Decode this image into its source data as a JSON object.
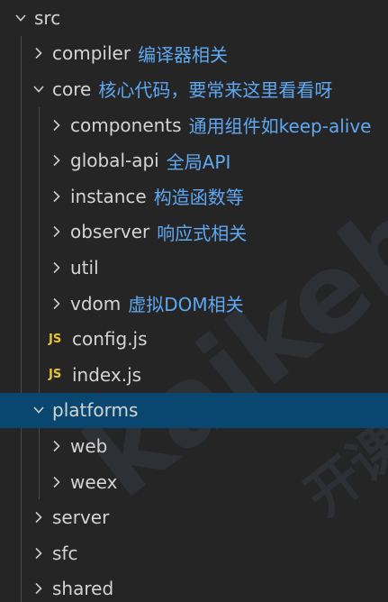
{
  "explorer": {
    "items": [
      {
        "label": "src",
        "note": "",
        "depth": 0,
        "icon": "chevron-down-icon",
        "expanded": true
      },
      {
        "label": "compiler",
        "note": "编译器相关",
        "depth": 1,
        "icon": "chevron-right-icon",
        "expanded": false
      },
      {
        "label": "core",
        "note": "核心代码，要常来这里看看呀",
        "depth": 1,
        "icon": "chevron-down-icon",
        "expanded": true
      },
      {
        "label": "components",
        "note": "通用组件如keep-alive",
        "depth": 2,
        "icon": "chevron-right-icon",
        "expanded": false
      },
      {
        "label": "global-api",
        "note": "全局API",
        "depth": 2,
        "icon": "chevron-right-icon",
        "expanded": false
      },
      {
        "label": "instance",
        "note": "构造函数等",
        "depth": 2,
        "icon": "chevron-right-icon",
        "expanded": false
      },
      {
        "label": "observer",
        "note": "响应式相关",
        "depth": 2,
        "icon": "chevron-right-icon",
        "expanded": false
      },
      {
        "label": "util",
        "note": "",
        "depth": 2,
        "icon": "chevron-right-icon",
        "expanded": false
      },
      {
        "label": "vdom",
        "note": "虚拟DOM相关",
        "depth": 2,
        "icon": "chevron-right-icon",
        "expanded": false
      },
      {
        "label": "config.js",
        "note": "",
        "depth": 2,
        "icon": "js-file-icon",
        "badge": "JS"
      },
      {
        "label": "index.js",
        "note": "",
        "depth": 2,
        "icon": "js-file-icon",
        "badge": "JS"
      },
      {
        "label": "platforms",
        "note": "",
        "depth": 1,
        "icon": "chevron-down-icon",
        "expanded": true,
        "selected": true
      },
      {
        "label": "web",
        "note": "",
        "depth": 2,
        "icon": "chevron-right-icon",
        "expanded": false
      },
      {
        "label": "weex",
        "note": "",
        "depth": 2,
        "icon": "chevron-right-icon",
        "expanded": false
      },
      {
        "label": "server",
        "note": "",
        "depth": 1,
        "icon": "chevron-right-icon",
        "expanded": false
      },
      {
        "label": "sfc",
        "note": "",
        "depth": 1,
        "icon": "chevron-right-icon",
        "expanded": false
      },
      {
        "label": "shared",
        "note": "",
        "depth": 1,
        "icon": "chevron-right-icon",
        "expanded": false
      }
    ]
  },
  "watermark": {
    "text": "kaikeba",
    "sub": "开课吧"
  },
  "colors": {
    "background": "#252526",
    "selected_row": "#094771",
    "folder_text": "#d4d4d4",
    "annotation_text": "#5fa8f2",
    "js_badge": "#e8c33a"
  }
}
